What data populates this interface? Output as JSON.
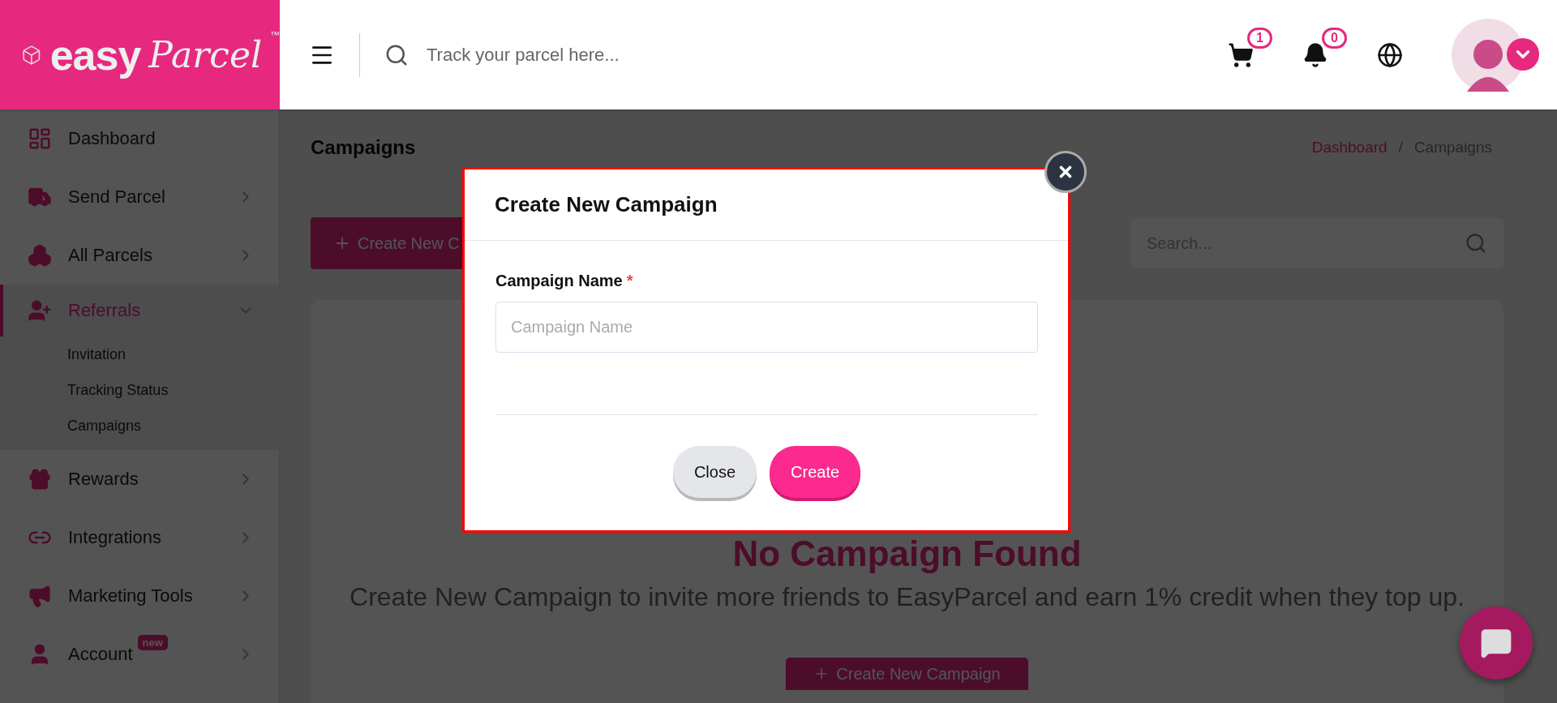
{
  "logo": {
    "word": "easy",
    "script": "Parcel",
    "mark": "™"
  },
  "header": {
    "search_placeholder": "Track your parcel here...",
    "cart_count": "1",
    "notification_count": "0"
  },
  "sidebar": {
    "items": [
      {
        "label": "Dashboard",
        "submenu": false,
        "selected": false,
        "expanded": false
      },
      {
        "label": "Send Parcel",
        "submenu": true,
        "selected": false,
        "expanded": false
      },
      {
        "label": "All Parcels",
        "submenu": true,
        "selected": false,
        "expanded": false
      },
      {
        "label": "Referrals",
        "submenu": true,
        "selected": true,
        "expanded": true,
        "children": [
          {
            "label": "Invitation"
          },
          {
            "label": "Tracking Status"
          },
          {
            "label": "Campaigns"
          }
        ]
      },
      {
        "label": "Rewards",
        "submenu": true,
        "selected": false,
        "expanded": false
      },
      {
        "label": "Integrations",
        "submenu": true,
        "selected": false,
        "expanded": false
      },
      {
        "label": "Marketing Tools",
        "submenu": true,
        "selected": false,
        "expanded": false
      },
      {
        "label": "Account",
        "submenu": true,
        "selected": false,
        "expanded": false,
        "badge": "new"
      }
    ]
  },
  "page": {
    "title": "Campaigns",
    "breadcrumb_separator": "/",
    "breadcrumb": [
      {
        "label": "Dashboard",
        "link": true
      },
      {
        "label": "Campaigns",
        "link": false
      }
    ],
    "create_button": "Create New C",
    "search_placeholder": "Search...",
    "empty_state": {
      "title": "No Campaign Found",
      "description": "Create New Campaign to invite more friends to EasyParcel and earn 1% credit when they top up.",
      "button": "Create New Campaign"
    }
  },
  "modal": {
    "title": "Create New Campaign",
    "field": {
      "label": "Campaign Name",
      "required_mark": "*",
      "placeholder": "Campaign Name"
    },
    "buttons": [
      {
        "label": "Close",
        "kind": "secondary"
      },
      {
        "label": "Create",
        "kind": "primary"
      }
    ]
  }
}
